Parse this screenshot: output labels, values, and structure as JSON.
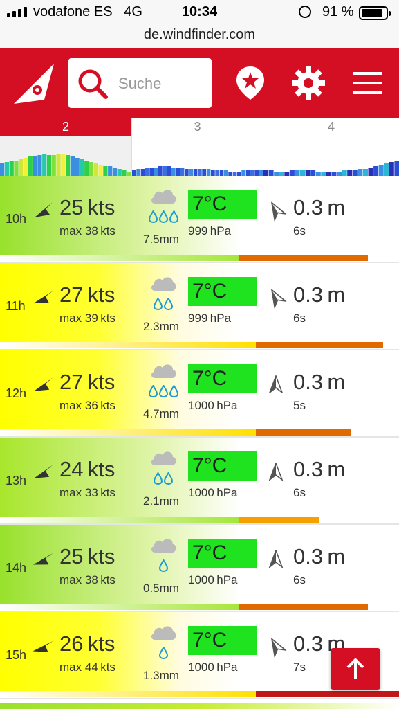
{
  "status_bar": {
    "carrier": "vodafone ES",
    "network": "4G",
    "time": "10:34",
    "battery": "91 %"
  },
  "browser": {
    "url": "de.windfinder.com"
  },
  "header": {
    "search_placeholder": "Suche"
  },
  "day_tabs": [
    {
      "label": "2",
      "active": true
    },
    {
      "label": "3",
      "active": false
    },
    {
      "label": "4",
      "active": false
    }
  ],
  "colors": {
    "brand_red": "#d40f23",
    "temp_green": "#1ee31e",
    "rain_blue": "#1e9bd6"
  },
  "rows": [
    {
      "hour": "10h",
      "speed": "25",
      "max": "38",
      "unit": "kts",
      "max_prefix": "max",
      "rain": "7.5",
      "rain_unit": "mm",
      "drops": "♒♒♒",
      "temp": "7°C",
      "pressure": "999",
      "pressure_unit": "hPa",
      "wave": "0.3",
      "wave_unit": "m",
      "period": "6s"
    },
    {
      "hour": "11h",
      "speed": "27",
      "max": "39",
      "unit": "kts",
      "max_prefix": "max",
      "rain": "2.3",
      "rain_unit": "mm",
      "drops": "♒♒",
      "temp": "7°C",
      "pressure": "999",
      "pressure_unit": "hPa",
      "wave": "0.3",
      "wave_unit": "m",
      "period": "6s"
    },
    {
      "hour": "12h",
      "speed": "27",
      "max": "36",
      "unit": "kts",
      "max_prefix": "max",
      "rain": "4.7",
      "rain_unit": "mm",
      "drops": "♒♒♒",
      "temp": "7°C",
      "pressure": "1000",
      "pressure_unit": "hPa",
      "wave": "0.3",
      "wave_unit": "m",
      "period": "5s"
    },
    {
      "hour": "13h",
      "speed": "24",
      "max": "33",
      "unit": "kts",
      "max_prefix": "max",
      "rain": "2.1",
      "rain_unit": "mm",
      "drops": "♒♒",
      "temp": "7°C",
      "pressure": "1000",
      "pressure_unit": "hPa",
      "wave": "0.3",
      "wave_unit": "m",
      "period": "6s"
    },
    {
      "hour": "14h",
      "speed": "25",
      "max": "38",
      "unit": "kts",
      "max_prefix": "max",
      "rain": "0.5",
      "rain_unit": "mm",
      "drops": "♒",
      "temp": "7°C",
      "pressure": "1000",
      "pressure_unit": "hPa",
      "wave": "0.3",
      "wave_unit": "m",
      "period": "6s"
    },
    {
      "hour": "15h",
      "speed": "26",
      "max": "44",
      "unit": "kts",
      "max_prefix": "max",
      "rain": "1.3",
      "rain_unit": "mm",
      "drops": "♒",
      "temp": "7°C",
      "pressure": "1000",
      "pressure_unit": "hPa",
      "wave": "0.3",
      "wave_unit": "m",
      "period": "7s"
    }
  ]
}
